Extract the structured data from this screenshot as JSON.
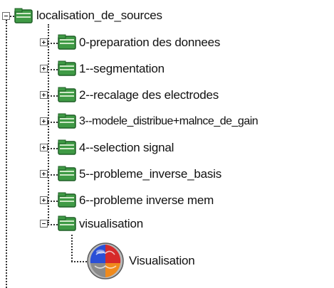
{
  "tree": {
    "root": {
      "label": "localisation_de_sources",
      "expanded": true
    },
    "children": [
      {
        "label": "0-preparation des donnees",
        "expanded": false
      },
      {
        "label": "1--segmentation",
        "expanded": false
      },
      {
        "label": "2--recalage des electrodes",
        "expanded": false
      },
      {
        "label": "3--modele_distribue+malnce_de_gain",
        "expanded": false
      },
      {
        "label": "4--selection signal",
        "expanded": false
      },
      {
        "label": "5--probleme_inverse_basis",
        "expanded": false
      },
      {
        "label": "6--probleme inverse mem",
        "expanded": false
      },
      {
        "label": "visualisation",
        "expanded": true
      }
    ],
    "leaf": {
      "label": "Visualisation",
      "icon": "brain-visualisation-icon"
    }
  },
  "colors": {
    "package_green": "#3f9a45",
    "package_dark": "#1f5f26",
    "guide_line": "#333333",
    "brain_blue": "#2a4fd6",
    "brain_red": "#d62a2a",
    "brain_orange": "#f08a1c"
  }
}
